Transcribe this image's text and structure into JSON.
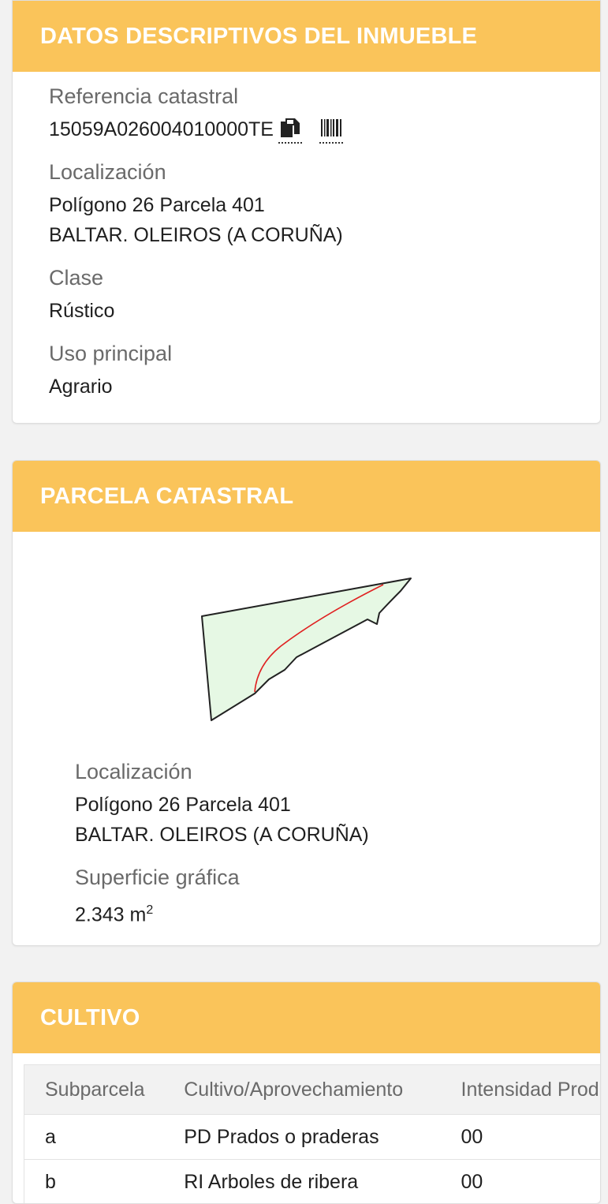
{
  "datos": {
    "header": "DATOS DESCRIPTIVOS DEL INMUEBLE",
    "referencia_label": "Referencia catastral",
    "referencia_value": "15059A026004010000TE",
    "copy_icon": "copy-icon",
    "barcode_icon": "barcode-icon",
    "localizacion_label": "Localización",
    "localizacion_line1": "Polígono 26 Parcela 401",
    "localizacion_line2": "BALTAR. OLEIROS (A CORUÑA)",
    "clase_label": "Clase",
    "clase_value": "Rústico",
    "uso_label": "Uso principal",
    "uso_value": "Agrario"
  },
  "parcela": {
    "header": "PARCELA CATASTRAL",
    "localizacion_label": "Localización",
    "localizacion_line1": "Polígono 26 Parcela 401",
    "localizacion_line2": "BALTAR. OLEIROS (A CORUÑA)",
    "superficie_label": "Superficie gráfica",
    "superficie_value": "2.343 m",
    "superficie_exp": "2"
  },
  "cultivo": {
    "header": "CULTIVO",
    "columns": [
      "Subparcela",
      "Cultivo/Aprovechamiento",
      "Intensidad Prod"
    ],
    "rows": [
      [
        "a",
        "PD Prados o praderas",
        "00"
      ],
      [
        "b",
        "RI Arboles de ribera",
        "00"
      ]
    ]
  },
  "colors": {
    "header_bg": "#fac45a",
    "header_text": "#ffffff",
    "parcel_fill": "#e6f8e4",
    "parcel_stroke": "#222222",
    "subparcel_line": "#e02020"
  }
}
